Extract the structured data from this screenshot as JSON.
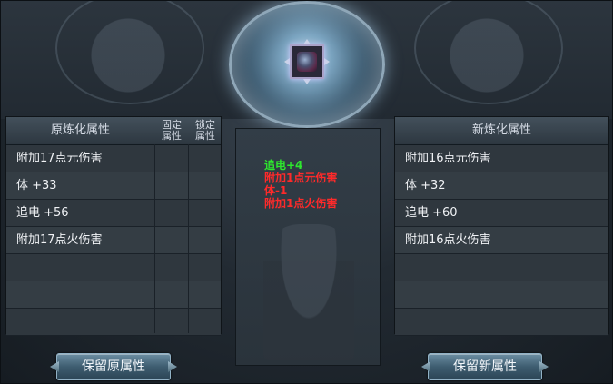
{
  "item": {
    "icon": "armor-icon"
  },
  "left_panel": {
    "title": "原炼化属性",
    "col_fixed": "固定\n属性",
    "col_lock": "锁定\n属性",
    "rows": [
      "附加17点元伤害",
      "体 +33",
      "追电 +56",
      "附加17点火伤害",
      "",
      "",
      ""
    ]
  },
  "right_panel": {
    "title": "新炼化属性",
    "rows": [
      "附加16点元伤害",
      "体 +32",
      "追电 +60",
      "附加16点火伤害",
      "",
      "",
      ""
    ]
  },
  "changes": [
    {
      "text": "追电+4",
      "color": "#2ee62e"
    },
    {
      "text": "附加1点元伤害",
      "color": "#ff2a2a"
    },
    {
      "text": "体-1",
      "color": "#ff2a2a"
    },
    {
      "text": "附加1点火伤害",
      "color": "#ff2a2a"
    }
  ],
  "buttons": {
    "keep_old": "保留原属性",
    "keep_new": "保留新属性"
  }
}
